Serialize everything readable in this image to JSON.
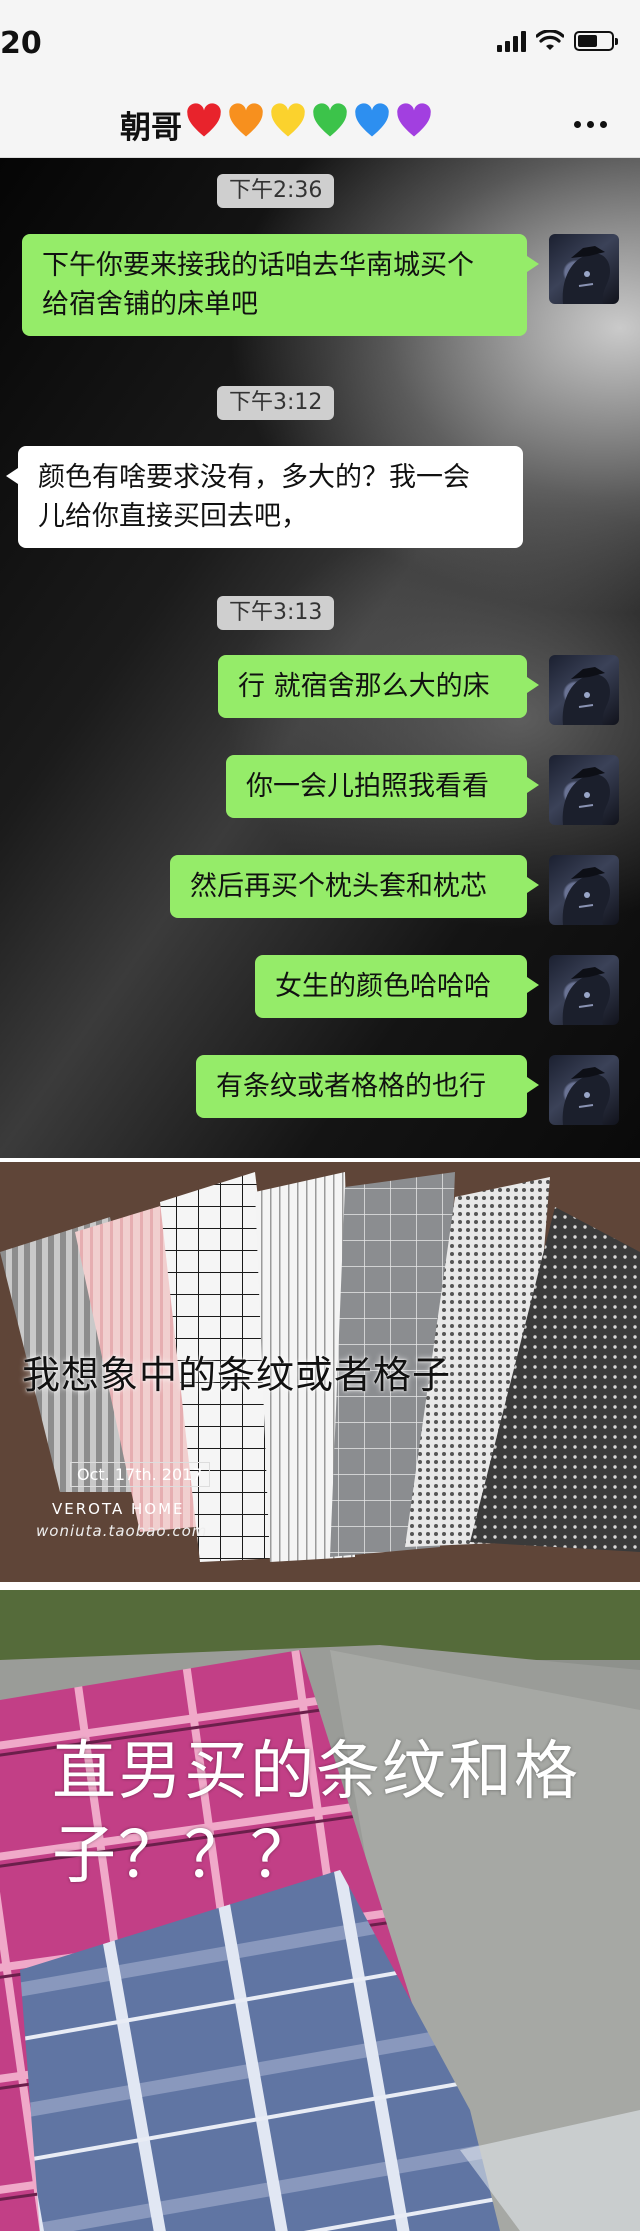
{
  "status_bar": {
    "time": "20",
    "signal_icon": "cellular-signal-icon",
    "wifi_icon": "wifi-icon",
    "battery_icon": "battery-icon",
    "battery_level": 0.6
  },
  "header": {
    "contact_name": "朝哥",
    "emoji": [
      "❤️",
      "🧡",
      "💛",
      "💚",
      "💙",
      "💜"
    ],
    "more_icon": "more-dots-icon"
  },
  "chat": {
    "bubble_colors": {
      "sent": "#95ec69",
      "received": "#ffffff"
    },
    "messages": [
      {
        "type": "time",
        "text": "下午2:36"
      },
      {
        "type": "sent",
        "lines": [
          "下午你要来接我的话咱去华南城买个",
          "给宿舍铺的床单吧"
        ]
      },
      {
        "type": "time",
        "text": "下午3:12"
      },
      {
        "type": "received",
        "lines": [
          "颜色有啥要求没有，多大的？我一会",
          "儿给你直接买回去吧，"
        ]
      },
      {
        "type": "time",
        "text": "下午3:13"
      },
      {
        "type": "sent",
        "lines": [
          "行 就宿舍那么大的床"
        ]
      },
      {
        "type": "sent",
        "lines": [
          "你一会儿拍照我看看"
        ]
      },
      {
        "type": "sent",
        "lines": [
          "然后再买个枕头套和枕芯"
        ]
      },
      {
        "type": "sent",
        "lines": [
          "女生的颜色哈哈哈"
        ]
      },
      {
        "type": "sent",
        "lines": [
          "有条纹或者格格的也行"
        ]
      }
    ]
  },
  "photo_fabric": {
    "caption": "我想象中的条纹或者格子",
    "watermark_date": "Oct. 17th. 2017",
    "watermark_brand": "VEROTA HOME",
    "watermark_url": "woniuta.taobao.com"
  },
  "photo_pillow": {
    "caption": "直男买的条纹和格子？？？"
  }
}
